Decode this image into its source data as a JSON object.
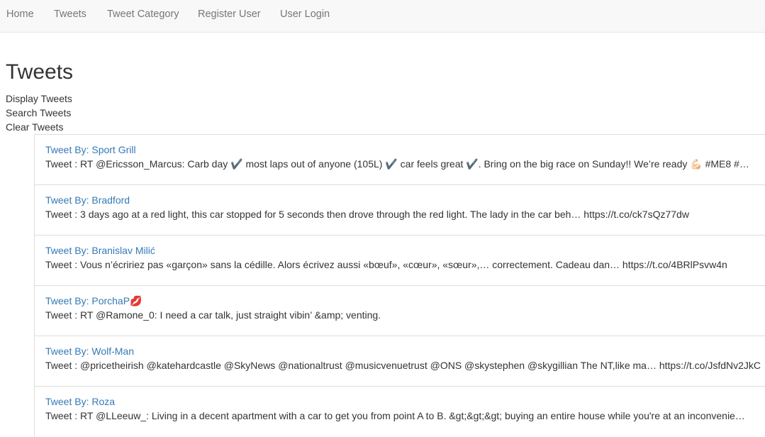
{
  "nav": {
    "items": [
      "Home",
      "Tweets",
      "Tweet Category",
      "Register User",
      "User Login"
    ]
  },
  "page": {
    "title": "Tweets"
  },
  "actions": {
    "display": "Display Tweets",
    "search": "Search Tweets",
    "clear": "Clear Tweets"
  },
  "tweets": [
    {
      "author": "Tweet By: Sport Grill",
      "text": "Tweet : RT @Ericsson_Marcus: Carb day ✔️ most laps out of anyone (105L) ✔️ car feels great ✔️. Bring on the big race on Sunday!! We’re ready 💪🏻 #ME8 #…"
    },
    {
      "author": "Tweet By: Bradford",
      "text": "Tweet : 3 days ago at a red light, this car stopped for 5 seconds then drove through the red light. The lady in the car beh… https://t.co/ck7sQz77dw"
    },
    {
      "author": "Tweet By: Branislav Milić",
      "text": "Tweet : Vous n’écririez pas «garçon» sans la cédille. Alors écrivez aussi «bœuf», «cœur», «sœur»,… correctement. Cadeau dan… https://t.co/4BRlPsvw4n"
    },
    {
      "author": "Tweet By: PorchaP💋",
      "text": "Tweet : RT @Ramone_0: I need a car talk, just straight vibin’ &amp; venting."
    },
    {
      "author": "Tweet By: Wolf-Man",
      "text": "Tweet : @pricetheirish @katehardcastle @SkyNews @nationaltrust @musicvenuetrust @ONS @skystephen @skygillian The NT,like ma… https://t.co/JsfdNv2JkC"
    },
    {
      "author": "Tweet By: Roza",
      "text": "Tweet : RT @LLeeuw_: Living in a decent apartment with a car to get you from point A to B. &gt;&gt;&gt; buying an entire house while you're at an inconvenie…"
    }
  ]
}
